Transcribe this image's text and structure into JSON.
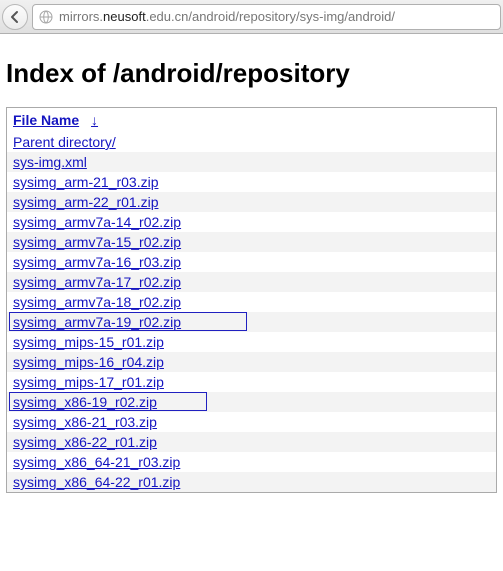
{
  "toolbar": {
    "url_prefix": "mirrors.",
    "url_host": "neusoft",
    "url_suffix": ".edu.cn/android/repository/sys-img/android/"
  },
  "page": {
    "heading": "Index of /android/repository"
  },
  "table": {
    "header": {
      "filename": "File Name",
      "arrow": "↓"
    },
    "rows": [
      {
        "label": "Parent directory/",
        "boxed": false
      },
      {
        "label": "sys-img.xml",
        "boxed": false
      },
      {
        "label": "sysimg_arm-21_r03.zip",
        "boxed": false
      },
      {
        "label": "sysimg_arm-22_r01.zip",
        "boxed": false
      },
      {
        "label": "sysimg_armv7a-14_r02.zip",
        "boxed": false
      },
      {
        "label": "sysimg_armv7a-15_r02.zip",
        "boxed": false
      },
      {
        "label": "sysimg_armv7a-16_r03.zip",
        "boxed": false
      },
      {
        "label": "sysimg_armv7a-17_r02.zip",
        "boxed": false
      },
      {
        "label": "sysimg_armv7a-18_r02.zip",
        "boxed": false
      },
      {
        "label": "sysimg_armv7a-19_r02.zip",
        "boxed": true,
        "boxw": 1
      },
      {
        "label": "sysimg_mips-15_r01.zip",
        "boxed": false
      },
      {
        "label": "sysimg_mips-16_r04.zip",
        "boxed": false
      },
      {
        "label": "sysimg_mips-17_r01.zip",
        "boxed": false
      },
      {
        "label": "sysimg_x86-19_r02.zip",
        "boxed": true,
        "boxw": 2
      },
      {
        "label": "sysimg_x86-21_r03.zip",
        "boxed": false
      },
      {
        "label": "sysimg_x86-22_r01.zip",
        "boxed": false
      },
      {
        "label": "sysimg_x86_64-21_r03.zip",
        "boxed": false
      },
      {
        "label": "sysimg_x86_64-22_r01.zip",
        "boxed": false
      }
    ]
  }
}
